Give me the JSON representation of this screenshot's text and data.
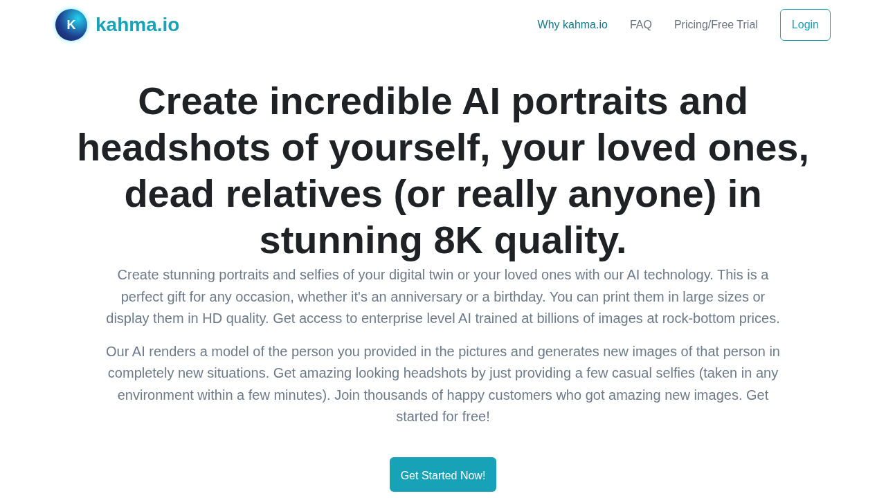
{
  "brand": {
    "logo_letter": "K",
    "name": "kahma.io"
  },
  "nav": [
    {
      "label": "Why kahma.io",
      "selected": true
    },
    {
      "label": "FAQ",
      "selected": false
    },
    {
      "label": "Pricing/Free Trial",
      "selected": false
    }
  ],
  "login_button": "Login",
  "hero": {
    "title": "Create incredible AI portraits and headshots of yourself, your loved ones, dead relatives (or really anyone) in stunning 8K quality.",
    "paragraphs": [
      "Create stunning portraits and selfies of your digital twin or your loved ones with our AI technology. This is a perfect gift for any occasion, whether it's an anniversary or a birthday. You can print them in large sizes or display them in HD quality. Get access to enterprise level AI trained at billions of images at rock-bottom prices.",
      "Our AI renders a model of the person you provided in the pictures and generates new images of that person in completely new situations. Get amazing looking headshots by just providing a few casual selfies (taken in any environment within a few minutes). Join thousands of happy customers who got amazing new images. Get started for free!"
    ],
    "cta": "Get Started Now!"
  }
}
